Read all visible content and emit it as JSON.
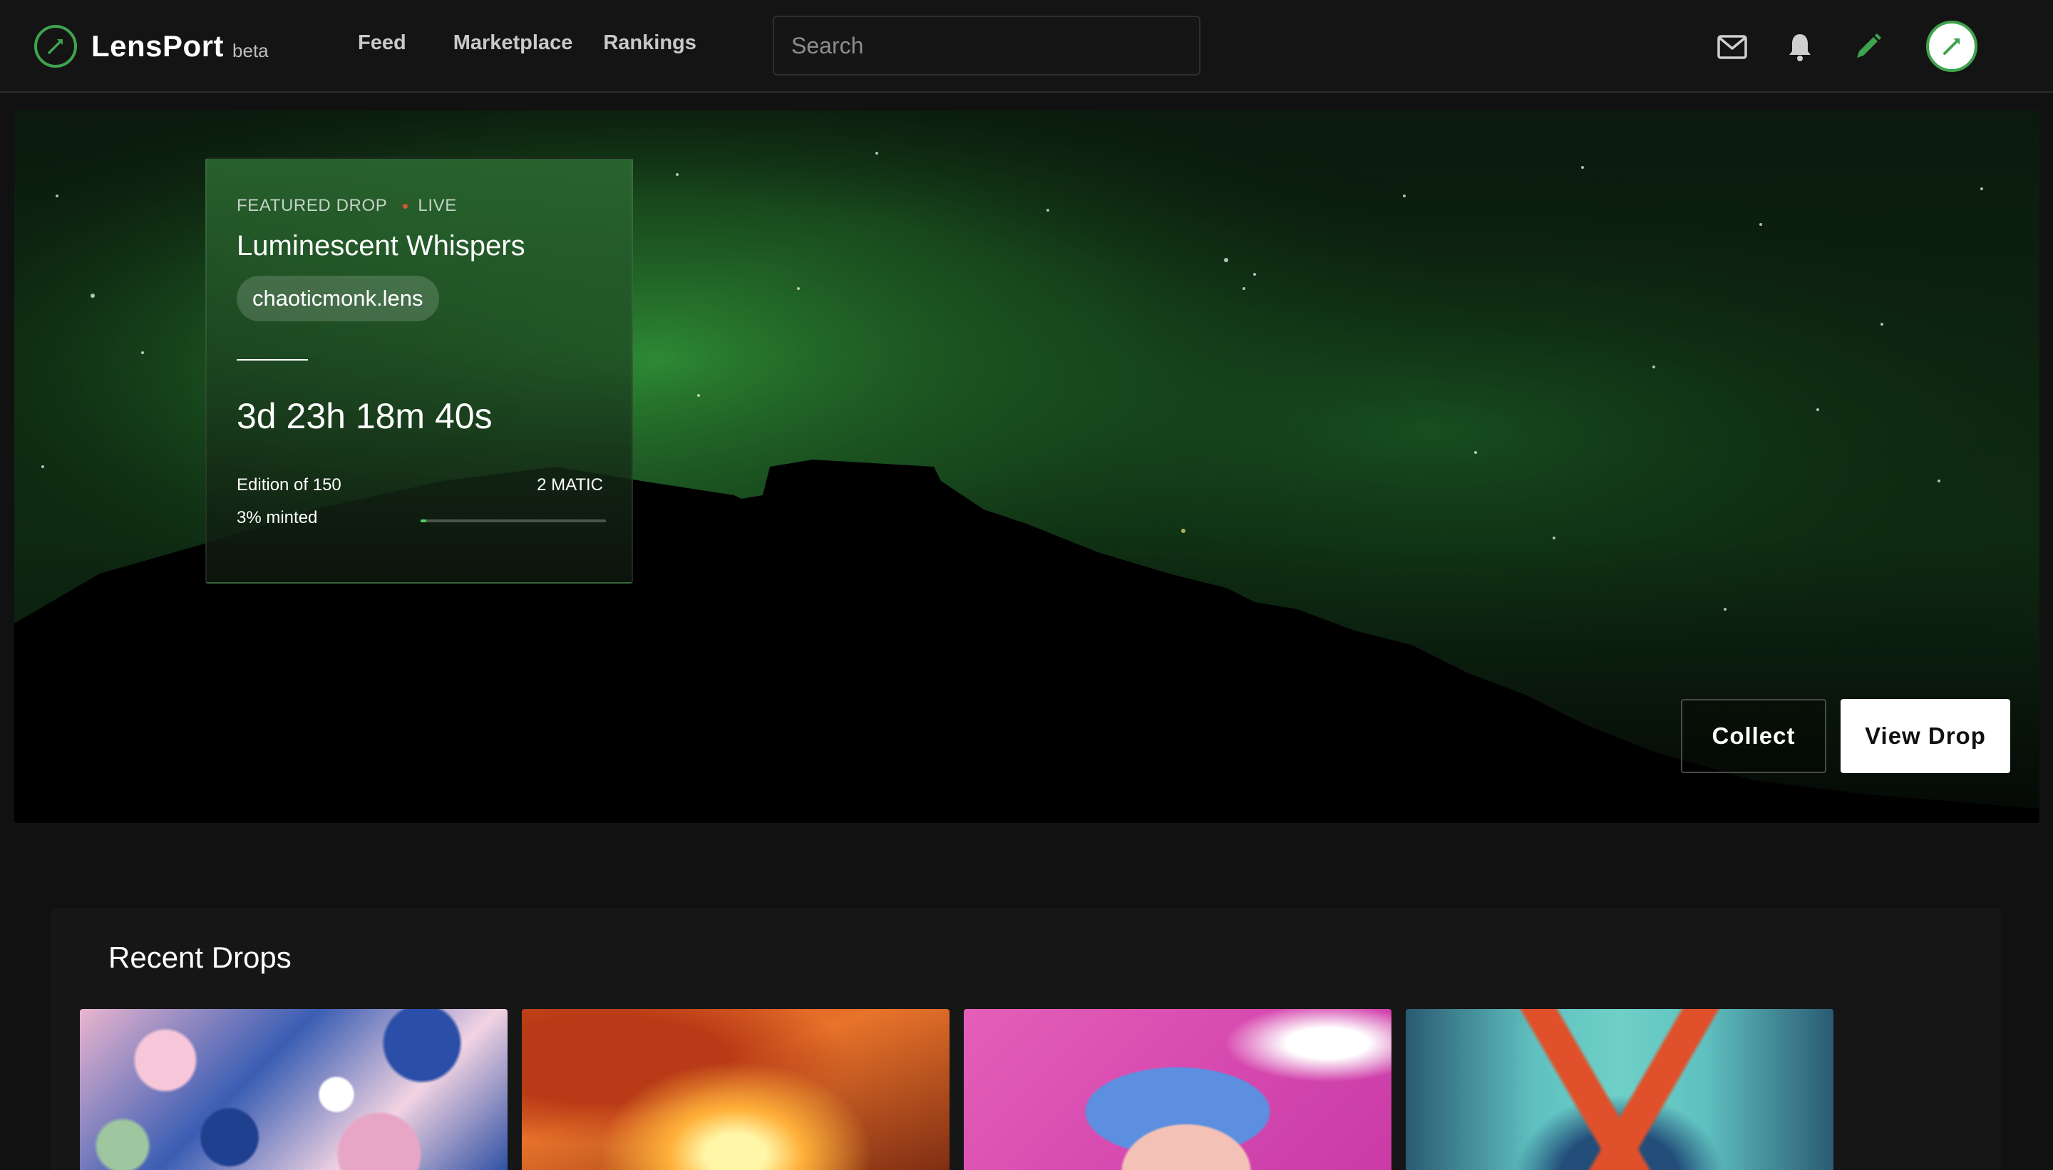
{
  "app": {
    "name": "LensPort",
    "badge": "beta"
  },
  "nav": {
    "items": [
      {
        "label": "Feed"
      },
      {
        "label": "Marketplace"
      },
      {
        "label": "Rankings"
      }
    ]
  },
  "search": {
    "placeholder": "Search",
    "value": ""
  },
  "header_icons": [
    "mail-icon",
    "bell-icon",
    "pencil-icon",
    "avatar"
  ],
  "hero": {
    "kicker": "FEATURED DROP",
    "status": "LIVE",
    "title": "Luminescent Whispers",
    "creator": "chaoticmonk.lens",
    "countdown": "3d 23h 18m 40s",
    "edition": "Edition of 150",
    "price": "2 MATIC",
    "minted_label": "3% minted",
    "minted_fraction": 0.03,
    "collect_label": "Collect",
    "view_label": "View Drop"
  },
  "recent": {
    "title": "Recent Drops",
    "count_visible": 4
  },
  "colors": {
    "accent": "#3fa34d",
    "background": "#111111",
    "live": "#d4553a",
    "progress": "#4fd35e"
  }
}
